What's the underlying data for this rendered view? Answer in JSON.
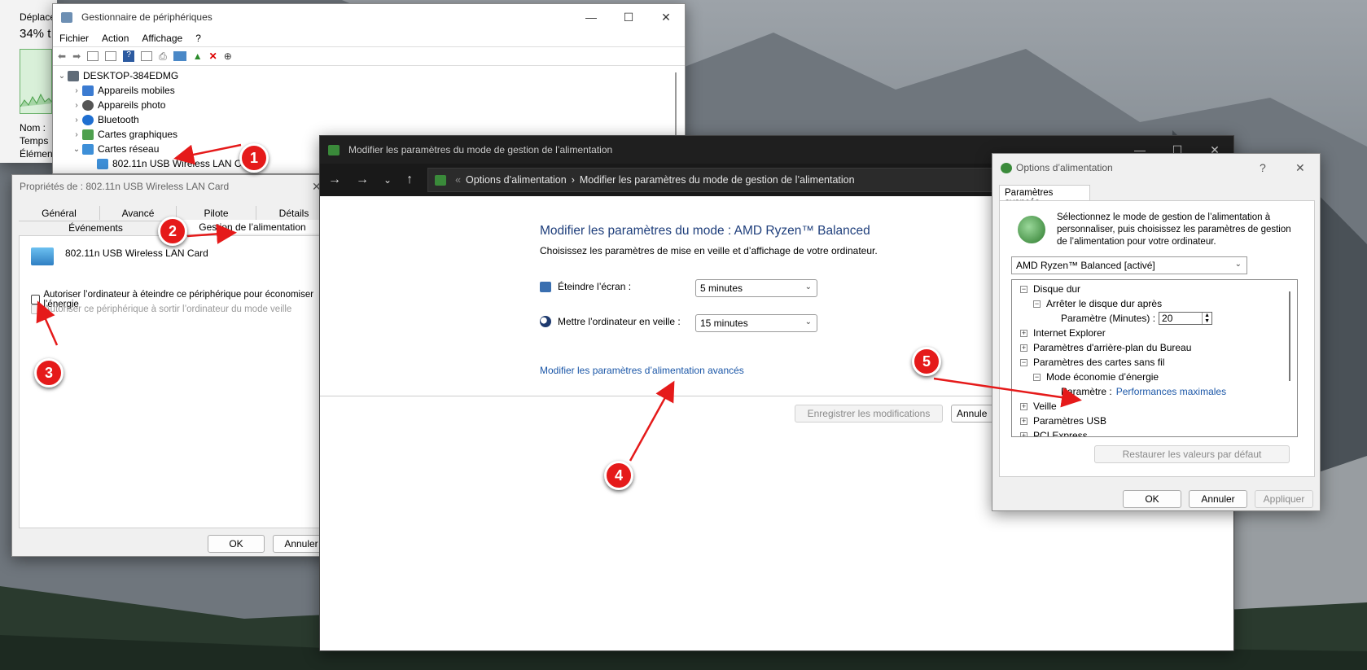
{
  "task_manager": {
    "label_move": "Déplace",
    "percent": "34% t",
    "fields": [
      "Nom :",
      "Temps",
      "Élémen"
    ]
  },
  "device_manager": {
    "title": "Gestionnaire de périphériques",
    "menu": [
      "Fichier",
      "Action",
      "Affichage",
      "?"
    ],
    "tree": {
      "root": "DESKTOP-384EDMG",
      "items": [
        "Appareils mobiles",
        "Appareils photo",
        "Bluetooth",
        "Cartes graphiques",
        "Cartes réseau"
      ],
      "child": "802.11n USB Wireless LAN Ca"
    }
  },
  "properties": {
    "title": "Propriétés de : 802.11n USB Wireless LAN Card",
    "tabs_row1": [
      "Général",
      "Avancé",
      "Pilote",
      "Détails"
    ],
    "tabs_row2": [
      "Événements",
      "Gestion de l’alimentation"
    ],
    "device_name": "802.11n USB Wireless LAN Card",
    "check1": "Autoriser l’ordinateur à éteindre ce périphérique pour économiser l’énergie",
    "check2": "Autoriser ce périphérique à sortir l’ordinateur du mode veille",
    "ok": "OK",
    "cancel": "Annuler"
  },
  "power_plan": {
    "title": "Modifier les paramètres du mode de gestion de l’alimentation",
    "breadcrumb_sep": "«",
    "breadcrumb1": "Options d’alimentation",
    "breadcrumb2": "Modifier les paramètres du mode de gestion de l’alimentation",
    "heading": "Modifier les paramètres du mode : AMD Ryzen™ Balanced",
    "subheading": "Choisissez les paramètres de mise en veille et d’affichage de votre ordinateur.",
    "screen_label": "Éteindre l’écran :",
    "screen_value": "5 minutes",
    "sleep_label": "Mettre l’ordinateur en veille :",
    "sleep_value": "15 minutes",
    "advanced_link": "Modifier les paramètres d’alimentation avancés",
    "save": "Enregistrer les modifications",
    "cancel": "Annule"
  },
  "power_options": {
    "title": "Options d’alimentation",
    "help": "?",
    "tab": "Paramètres avancés",
    "description": "Sélectionnez le mode de gestion de l’alimentation à personnaliser, puis choisissez les paramètres de gestion de l’alimentation pour votre ordinateur.",
    "plan": "AMD Ryzen™ Balanced [activé]",
    "tree": {
      "disk": "Disque dur",
      "disk_child": "Arrêter le disque dur après",
      "disk_param_label": "Paramètre (Minutes) :",
      "disk_param_value": "20",
      "ie": "Internet Explorer",
      "desktop_bg": "Paramètres d'arrière-plan du Bureau",
      "wireless": "Paramètres des cartes sans fil",
      "wireless_child": "Mode économie d’énergie",
      "wireless_param_label": "Paramètre :",
      "wireless_param_value": "Performances maximales",
      "sleep": "Veille",
      "usb": "Paramètres USB",
      "pci": "PCI Express"
    },
    "restore": "Restaurer les valeurs par défaut",
    "ok": "OK",
    "cancel": "Annuler",
    "apply": "Appliquer"
  },
  "callouts": [
    "1",
    "2",
    "3",
    "4",
    "5"
  ],
  "colors": {
    "callout": "#e51a1a",
    "link": "#1a56a7",
    "dark_titlebar": "#1f1f1f"
  }
}
